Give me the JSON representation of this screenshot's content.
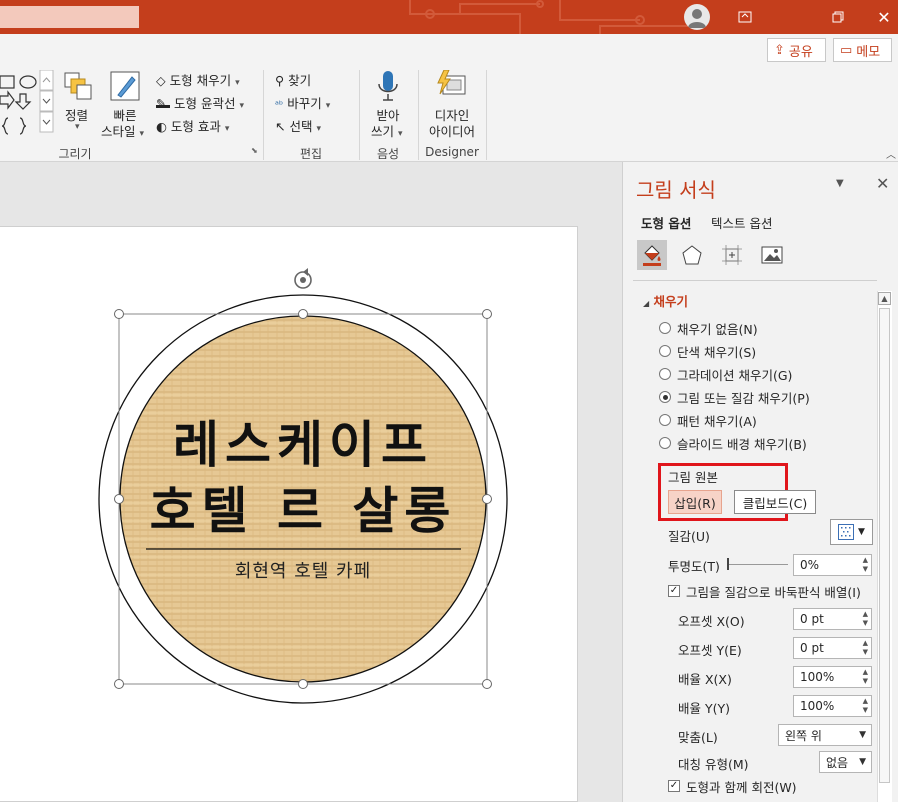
{
  "colors": {
    "accent": "#c43e1c",
    "highlight": "#e0151b"
  },
  "ribbon": {
    "share": "공유",
    "memo": "메모",
    "arrange": "정렬",
    "quick_style_l1": "빠른",
    "quick_style_l2": "스타일",
    "shape_fill": "도형 채우기",
    "shape_outline": "도형 윤곽선",
    "shape_effects": "도형 효과",
    "find": "찾기",
    "replace": "바꾸기",
    "select": "선택",
    "dictate_l1": "받아",
    "dictate_l2": "쓰기",
    "designer_l1": "디자인",
    "designer_l2": "아이디어",
    "groups": {
      "drawing": "그리기",
      "editing": "편집",
      "voice": "음성",
      "designer": "Designer"
    }
  },
  "slide": {
    "line1": "레스케이프",
    "line2": "호텔 르 살롱",
    "subtitle": "회현역 호텔 카페"
  },
  "pane": {
    "title": "그림 서식",
    "tabs": [
      "도형 옵션",
      "텍스트 옵션"
    ],
    "icons": [
      "fill-line-icon",
      "effects-icon",
      "size-properties-icon",
      "picture-icon"
    ],
    "section": "채우기",
    "fill_options": [
      {
        "label": "채우기 없음(N)",
        "selected": false
      },
      {
        "label": "단색 채우기(S)",
        "selected": false
      },
      {
        "label": "그라데이션 채우기(G)",
        "selected": false
      },
      {
        "label": "그림 또는 질감 채우기(P)",
        "selected": true
      },
      {
        "label": "패턴 채우기(A)",
        "selected": false
      },
      {
        "label": "슬라이드 배경 채우기(B)",
        "selected": false
      }
    ],
    "picture_source": "그림 원본",
    "insert": "삽입(R)",
    "clipboard": "클립보드(C)",
    "texture": "질감(U)",
    "transparency": "투명도(T)",
    "transparency_value": "0%",
    "tile_label": "그림을 질감으로 바둑판식 배열(I)",
    "tile_checked": true,
    "offset_x": "오프셋 X(O)",
    "offset_x_value": "0 pt",
    "offset_y": "오프셋 Y(E)",
    "offset_y_value": "0 pt",
    "scale_x": "배율 X(X)",
    "scale_x_value": "100%",
    "scale_y": "배율 Y(Y)",
    "scale_y_value": "100%",
    "alignment": "맞춤(L)",
    "alignment_value": "왼쪽 위",
    "mirror": "대칭 유형(M)",
    "mirror_value": "없음",
    "rotate_label": "도형과 함께 회전(W)",
    "rotate_checked": true
  }
}
